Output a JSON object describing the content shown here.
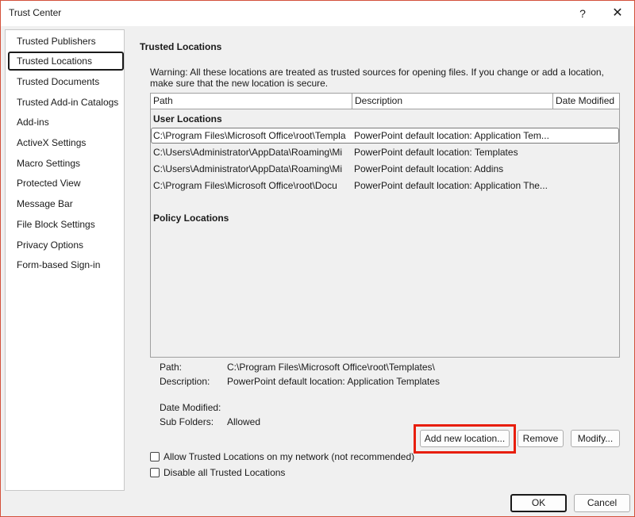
{
  "window": {
    "title": "Trust Center",
    "help_glyph": "?",
    "close_glyph": "✕"
  },
  "sidebar": {
    "items": [
      {
        "label": "Trusted Publishers"
      },
      {
        "label": "Trusted Locations",
        "selected": true
      },
      {
        "label": "Trusted Documents"
      },
      {
        "label": "Trusted Add-in Catalogs"
      },
      {
        "label": "Add-ins"
      },
      {
        "label": "ActiveX Settings"
      },
      {
        "label": "Macro Settings"
      },
      {
        "label": "Protected View"
      },
      {
        "label": "Message Bar"
      },
      {
        "label": "File Block Settings"
      },
      {
        "label": "Privacy Options"
      },
      {
        "label": "Form-based Sign-in"
      }
    ]
  },
  "main": {
    "section_title": "Trusted Locations",
    "warning": "Warning: All these locations are treated as trusted sources for opening files.  If you change or add a location, make sure that the new location is secure.",
    "table": {
      "columns": [
        "Path",
        "Description",
        "Date Modified"
      ],
      "user_group_label": "User Locations",
      "user_rows": [
        {
          "path": "C:\\Program Files\\Microsoft Office\\root\\Templa",
          "description": "PowerPoint default location: Application Tem...",
          "selected": true
        },
        {
          "path": "C:\\Users\\Administrator\\AppData\\Roaming\\Mi",
          "description": "PowerPoint default location: Templates"
        },
        {
          "path": "C:\\Users\\Administrator\\AppData\\Roaming\\Mi",
          "description": "PowerPoint default location: Addins"
        },
        {
          "path": "C:\\Program Files\\Microsoft Office\\root\\Docu",
          "description": "PowerPoint default location: Application The..."
        }
      ],
      "policy_group_label": "Policy Locations"
    },
    "details": {
      "path_label": "Path:",
      "path_value": "C:\\Program Files\\Microsoft Office\\root\\Templates\\",
      "description_label": "Description:",
      "description_value": "PowerPoint default location: Application Templates",
      "date_modified_label": "Date Modified:",
      "sub_folders_label": "Sub Folders:",
      "sub_folders_value": "Allowed"
    },
    "buttons": {
      "add_new": "Add new location...",
      "remove": "Remove",
      "modify": "Modify..."
    },
    "checkboxes": {
      "allow_network": "Allow Trusted Locations on my network (not recommended)",
      "disable_all": "Disable all Trusted Locations"
    }
  },
  "footer": {
    "ok": "OK",
    "cancel": "Cancel"
  },
  "colors": {
    "highlight": "#e81e0c",
    "window_border": "#d4513b"
  }
}
